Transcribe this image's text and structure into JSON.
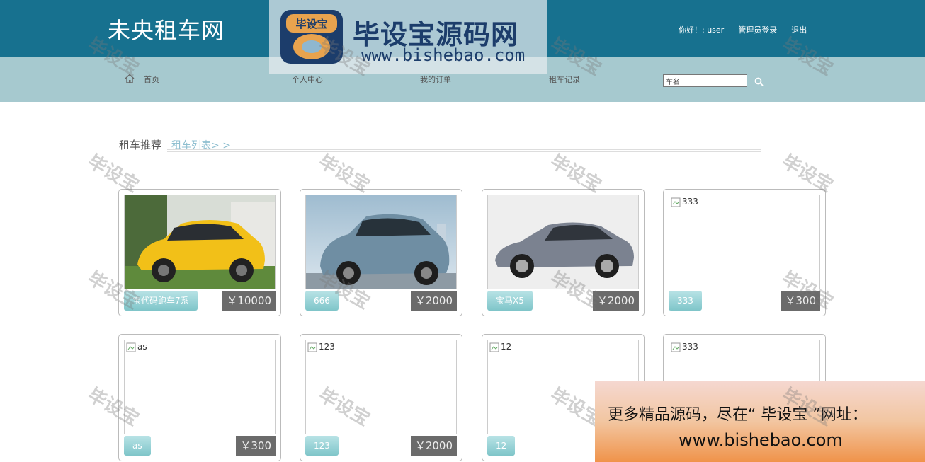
{
  "header": {
    "site_title": "未央租车网",
    "greeting": "你好！: user",
    "admin_login": "管理员登录",
    "logout": "退出"
  },
  "nav": {
    "home": "首页",
    "profile": "个人中心",
    "orders": "我的订单",
    "records": "租车记录",
    "search_placeholder": "车名"
  },
  "section": {
    "title": "租车推荐",
    "link": "租车列表> >"
  },
  "cars": [
    {
      "name": "宝代码跑车7系",
      "price": "￥10000",
      "alt": ""
    },
    {
      "name": "666",
      "price": "￥2000",
      "alt": ""
    },
    {
      "name": "宝马X5",
      "price": "￥2000",
      "alt": ""
    },
    {
      "name": "333",
      "price": "￥300",
      "alt": "333"
    },
    {
      "name": "as",
      "price": "￥300",
      "alt": "as"
    },
    {
      "name": "123",
      "price": "￥2000",
      "alt": "123"
    },
    {
      "name": "12",
      "price": "",
      "alt": "12"
    },
    {
      "name": "",
      "price": "",
      "alt": "333"
    }
  ],
  "watermark": {
    "logo_text": "毕设宝源码网",
    "logo_url": "www.bishebao.com",
    "badge_text": "毕设宝",
    "diag_text": "毕设宝",
    "promo_line1": "更多精品源码，尽在“ 毕设宝 ”网址：",
    "promo_line2": "www.bishebao.com"
  }
}
